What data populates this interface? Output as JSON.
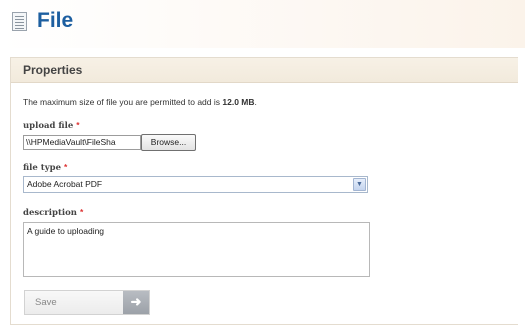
{
  "header": {
    "icon": "document-list-icon",
    "title": "File"
  },
  "panel": {
    "title": "Properties",
    "note_prefix": "The maximum size of file you are permitted to add is ",
    "note_size": "12.0 MB",
    "note_suffix": "."
  },
  "upload": {
    "label": "upload file",
    "required_mark": "*",
    "value": "\\\\HPMediaVault\\FileSha",
    "browse_label": "Browse..."
  },
  "file_type": {
    "label": "file type",
    "required_mark": "*",
    "selected": "Adobe Acrobat PDF",
    "arrow_icon": "chevron-down-icon"
  },
  "description": {
    "label": "description",
    "required_mark": "*",
    "value": "A guide to uploading"
  },
  "actions": {
    "save_label": "Save",
    "save_icon": "arrow-right-icon"
  }
}
